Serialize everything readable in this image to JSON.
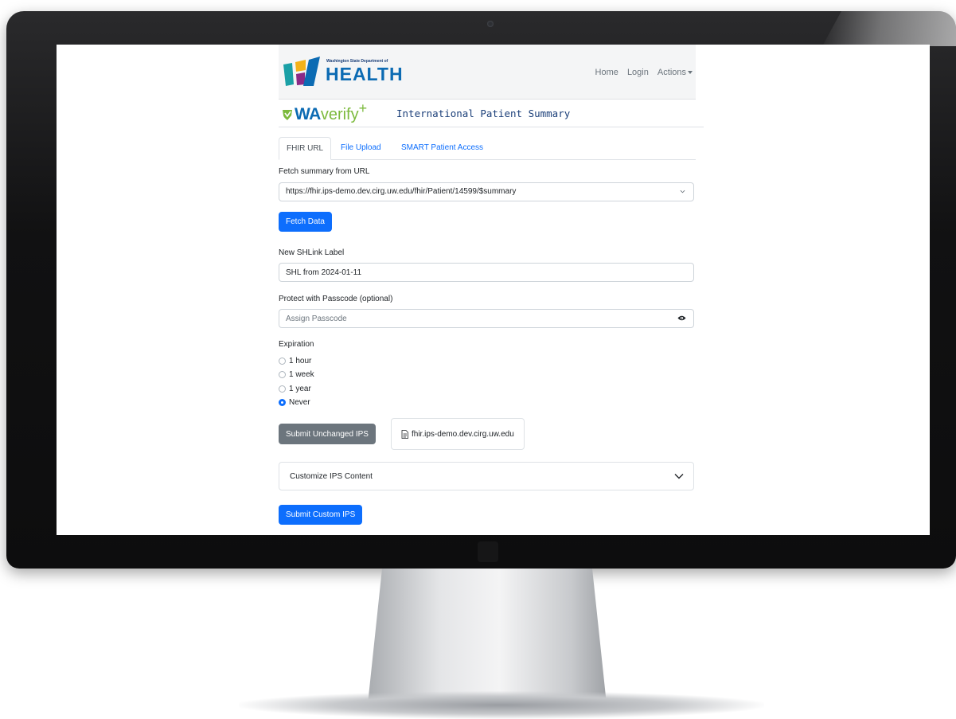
{
  "header": {
    "org_small": "Washington State Department of",
    "org_big": "HEALTH",
    "nav": {
      "home": "Home",
      "login": "Login",
      "actions": "Actions"
    }
  },
  "brand": {
    "wa": "WA",
    "verify": "verify",
    "plus": "+",
    "title": "International Patient Summary"
  },
  "tabs": [
    {
      "label": "FHIR URL",
      "active": true
    },
    {
      "label": "File Upload",
      "active": false
    },
    {
      "label": "SMART Patient Access",
      "active": false
    }
  ],
  "form": {
    "fetch_label": "Fetch summary from URL",
    "fetch_url": "https://fhir.ips-demo.dev.cirg.uw.edu/fhir/Patient/14599/$summary",
    "fetch_button": "Fetch Data",
    "shlink_label": "New SHLink Label",
    "shlink_value": "SHL from 2024-01-11",
    "passcode_label": "Protect with Passcode (optional)",
    "passcode_placeholder": "Assign Passcode",
    "expiration_label": "Expiration",
    "expiration_options": [
      "1 hour",
      "1 week",
      "1 year",
      "Never"
    ],
    "expiration_selected": "Never",
    "submit_unchanged": "Submit Unchanged IPS",
    "source_file": "fhir.ips-demo.dev.cirg.uw.edu",
    "customize_label": "Customize IPS Content",
    "submit_custom": "Submit Custom IPS"
  },
  "colors": {
    "primary": "#0d6efd",
    "secondary": "#6c757d",
    "wa_blue": "#0c6bb3",
    "wa_green": "#7cba3d"
  },
  "icons": [
    "chevron-down-icon",
    "eye-icon",
    "file-icon",
    "shield-icon",
    "caret-down-icon"
  ]
}
